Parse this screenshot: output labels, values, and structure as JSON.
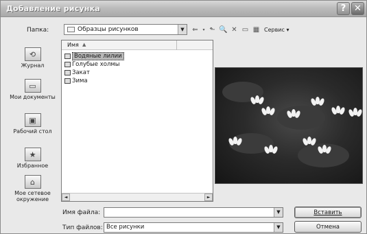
{
  "window": {
    "title": "Добавление рисунка",
    "help_glyph": "?",
    "close_glyph": "✕"
  },
  "folder": {
    "label": "Папка:",
    "value": "Образцы рисунков",
    "dropdown_glyph": "▼"
  },
  "toolbar": {
    "back_glyph": "⇐",
    "up_glyph": "⬑",
    "search_glyph": "🔍",
    "delete_glyph": "✕",
    "newfolder_glyph": "▭",
    "views_glyph": "▦",
    "service_label": "Сервис ▾"
  },
  "places": [
    {
      "label": "Журнал",
      "icon": "history-icon",
      "glyph": "⟲"
    },
    {
      "label": "Мои документы",
      "icon": "documents-folder-icon",
      "glyph": "▭"
    },
    {
      "label": "Рабочий стол",
      "icon": "desktop-icon",
      "glyph": "▣"
    },
    {
      "label": "Избранное",
      "icon": "favorites-icon",
      "glyph": "★"
    },
    {
      "label": "Мое сетевое окружение",
      "icon": "network-icon",
      "glyph": "⌂"
    }
  ],
  "file_list": {
    "column_name": "Имя",
    "sort_glyph": "▲",
    "items": [
      {
        "name": "Водяные лилии",
        "selected": true
      },
      {
        "name": "Голубые холмы",
        "selected": false
      },
      {
        "name": "Закат",
        "selected": false
      },
      {
        "name": "Зима",
        "selected": false
      }
    ],
    "scroll_left": "◄",
    "scroll_right": "►"
  },
  "file_name": {
    "label": "Имя файла:",
    "value": ""
  },
  "file_type": {
    "label": "Тип файлов:",
    "value": "Все рисунки"
  },
  "buttons": {
    "insert": "Вставить",
    "cancel": "Отмена"
  }
}
